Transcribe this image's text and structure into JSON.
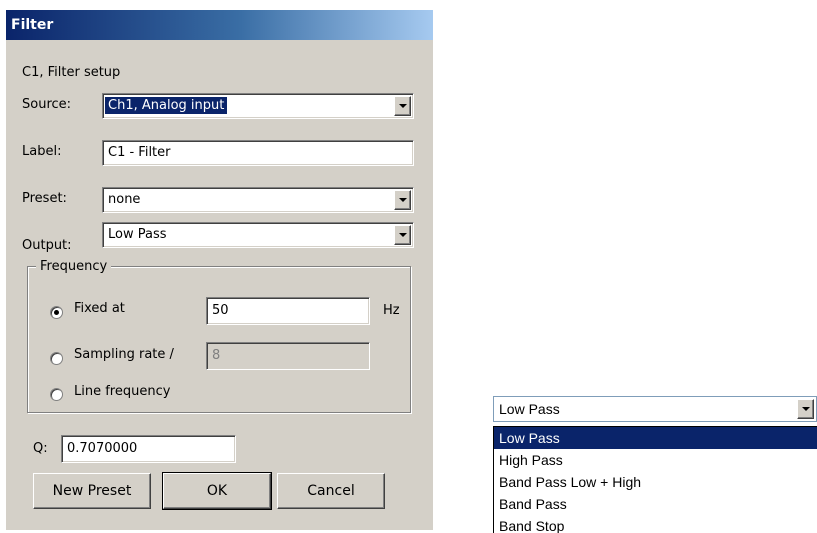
{
  "dialog": {
    "title": "Filter",
    "subtitle": "C1, Filter setup",
    "source": {
      "label": "Source:",
      "value": "Ch1, Analog input"
    },
    "label_field": {
      "label": "Label:",
      "value": "C1 - Filter"
    },
    "preset": {
      "label": "Preset:",
      "value": "none"
    },
    "output": {
      "label": "Output:",
      "value": "Low Pass"
    },
    "frequency": {
      "group_label": "Frequency",
      "options": [
        {
          "label": "Fixed at",
          "checked": true,
          "value": "50",
          "unit": "Hz"
        },
        {
          "label": "Sampling rate /",
          "checked": false,
          "value": "8"
        },
        {
          "label": "Line frequency",
          "checked": false
        }
      ]
    },
    "q": {
      "label": "Q:",
      "value": "0.7070000"
    },
    "buttons": {
      "new_preset": "New Preset",
      "ok": "OK",
      "cancel": "Cancel"
    }
  },
  "dropdown_popup": {
    "selected_value": "Low Pass",
    "items": [
      "Low Pass",
      "High Pass",
      "Band Pass Low + High",
      "Band Pass",
      "Band Stop"
    ],
    "highlighted_index": 0
  },
  "colors": {
    "dialog_bg": "#d4d0c8",
    "title_bar": "#0a246a",
    "selection": "#0a246a"
  }
}
